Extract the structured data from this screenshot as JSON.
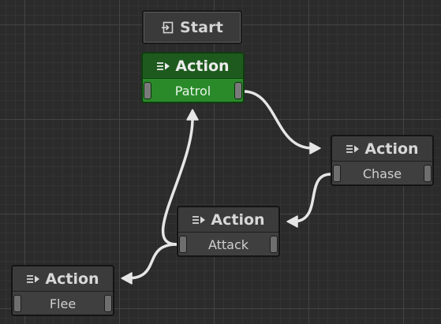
{
  "graph": {
    "start_node": {
      "label": "Start",
      "icon": "enter-icon"
    },
    "nodes": [
      {
        "id": "patrol",
        "title": "Action",
        "subtitle": "Patrol",
        "icon": "action-icon",
        "active": true
      },
      {
        "id": "chase",
        "title": "Action",
        "subtitle": "Chase",
        "icon": "action-icon",
        "active": false
      },
      {
        "id": "attack",
        "title": "Action",
        "subtitle": "Attack",
        "icon": "action-icon",
        "active": false
      },
      {
        "id": "flee",
        "title": "Action",
        "subtitle": "Flee",
        "icon": "action-icon",
        "active": false
      }
    ],
    "edges": [
      {
        "from": "patrol",
        "to": "chase"
      },
      {
        "from": "chase",
        "to": "attack"
      },
      {
        "from": "attack",
        "to": "patrol"
      },
      {
        "from": "attack",
        "to": "flee"
      }
    ]
  },
  "colors": {
    "background": "#2b2b2b",
    "active_header": "#1e5a1e",
    "active_body": "#2a8a2a",
    "node_header": "#3b3b3b",
    "node_body": "#3f3f3f",
    "edge": "#e6e6e6"
  }
}
